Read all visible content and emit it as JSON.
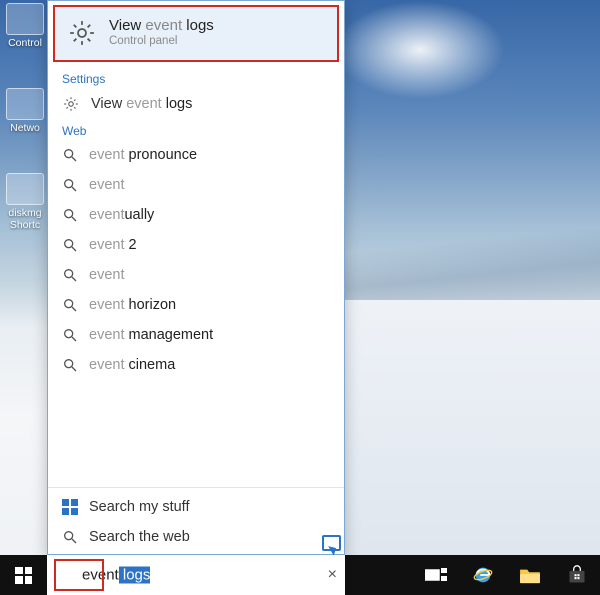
{
  "desktop_icons": [
    {
      "label": "Control"
    },
    {
      "label": "Netwo"
    },
    {
      "label": "diskmg Shortc"
    }
  ],
  "best_match": {
    "title_pre": "View ",
    "title_dim": "event",
    "title_post": " logs",
    "subtitle": "Control panel"
  },
  "sections": {
    "settings_header": "Settings",
    "web_header": "Web"
  },
  "settings_results": [
    {
      "pre": "View ",
      "dim": "event",
      "post": " logs"
    }
  ],
  "web_results": [
    {
      "dim": "event",
      "post": "   pronounce"
    },
    {
      "dim": "event",
      "post": ""
    },
    {
      "dim": "event",
      "post": "ually"
    },
    {
      "dim": "event",
      "post": " 2"
    },
    {
      "dim": "event",
      "post": ""
    },
    {
      "dim": "event",
      "post": " horizon"
    },
    {
      "dim": "event",
      "post": " management"
    },
    {
      "dim": "event",
      "post": " cinema"
    }
  ],
  "bottom": {
    "my_stuff": "Search my stuff",
    "web": "Search the web"
  },
  "searchbox": {
    "typed": "event",
    "autocomplete": " logs",
    "clear_symbol": "×"
  }
}
